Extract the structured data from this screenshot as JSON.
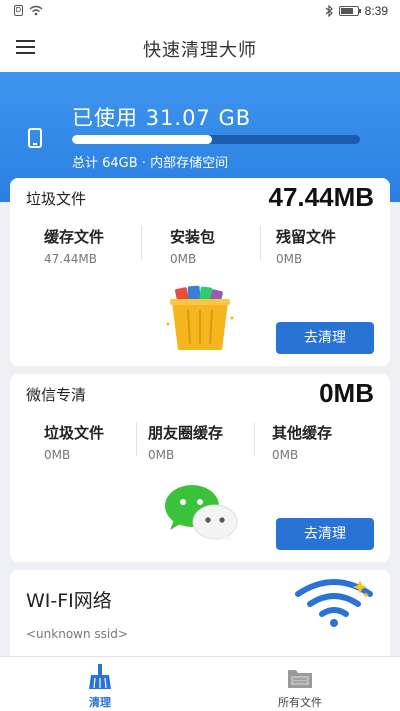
{
  "status_bar": {
    "time": "8:39",
    "sim_label": "D"
  },
  "app_bar": {
    "title": "快速清理大师"
  },
  "storage": {
    "used_text": "已使用 31.07 GB",
    "total_text": "总计 64GB · 内部存储空间",
    "used_fraction": 0.486
  },
  "junk_card": {
    "title": "垃圾文件",
    "size": "47.44MB",
    "stats": [
      {
        "label": "缓存文件",
        "value": "47.44MB"
      },
      {
        "label": "安装包",
        "value": "0MB"
      },
      {
        "label": "残留文件",
        "value": "0MB"
      }
    ],
    "button_label": "去清理"
  },
  "wechat_card": {
    "title": "微信专清",
    "size": "0MB",
    "stats": [
      {
        "label": "垃圾文件",
        "value": "0MB"
      },
      {
        "label": "朋友圈缓存",
        "value": "0MB"
      },
      {
        "label": "其他缓存",
        "value": "0MB"
      }
    ],
    "button_label": "去清理"
  },
  "wifi_card": {
    "title": "WI-FI网络",
    "ssid": "<unknown ssid>"
  },
  "bottom_nav": {
    "items": [
      {
        "label": "清理",
        "active": true
      },
      {
        "label": "所有文件",
        "active": false
      }
    ]
  },
  "colors": {
    "accent": "#2a73d6",
    "banner": "#3f95ee",
    "wechat_green": "#3bc23b"
  },
  "icons": [
    "menu-icon",
    "phone-icon",
    "trash-bin-icon",
    "wechat-icon",
    "wifi-icon",
    "broom-icon",
    "folder-icon"
  ]
}
